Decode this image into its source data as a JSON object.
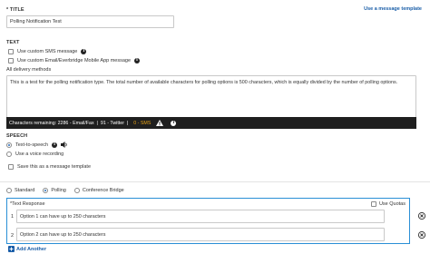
{
  "title_section": {
    "label": "TITLE",
    "required_marker": "*",
    "template_link": "Use a message template",
    "value": "Polling Notification Test"
  },
  "text_section": {
    "label": "TEXT",
    "custom_sms": "Use custom SMS message",
    "custom_app": "Use custom Email/Everbridge Mobile App message",
    "all_methods": "All delivery methods",
    "body": "This is a test for the polling notification type. The total number of available characters for polling options is 500 characters, which is equally divided by the number of polling options.",
    "counter_prefix": "Characters remaining: 2286 - Email/Fax  |  91 - Twitter  |  ",
    "counter_sms": "0 - SMS",
    "counter_bar_color": "#1f1f1f",
    "sms_warning_color": "#e8a317"
  },
  "speech_section": {
    "label": "SPEECH",
    "tts": "Text-to-speech",
    "voice_recording": "Use a voice recording",
    "save_template": "Save this as a message template"
  },
  "message_type": {
    "options": [
      "Standard",
      "Polling",
      "Conference Bridge"
    ],
    "selected": "Polling"
  },
  "response": {
    "label": "Text Response",
    "required_marker": "*",
    "quotas": "Use Quotas",
    "options": [
      {
        "num": "1",
        "value": "Option 1 can have up to 250 characters"
      },
      {
        "num": "2",
        "value": "Option 2 can have up to 250 characters"
      }
    ],
    "add_another": "Add Another",
    "accent_color": "#2a8fd6"
  }
}
